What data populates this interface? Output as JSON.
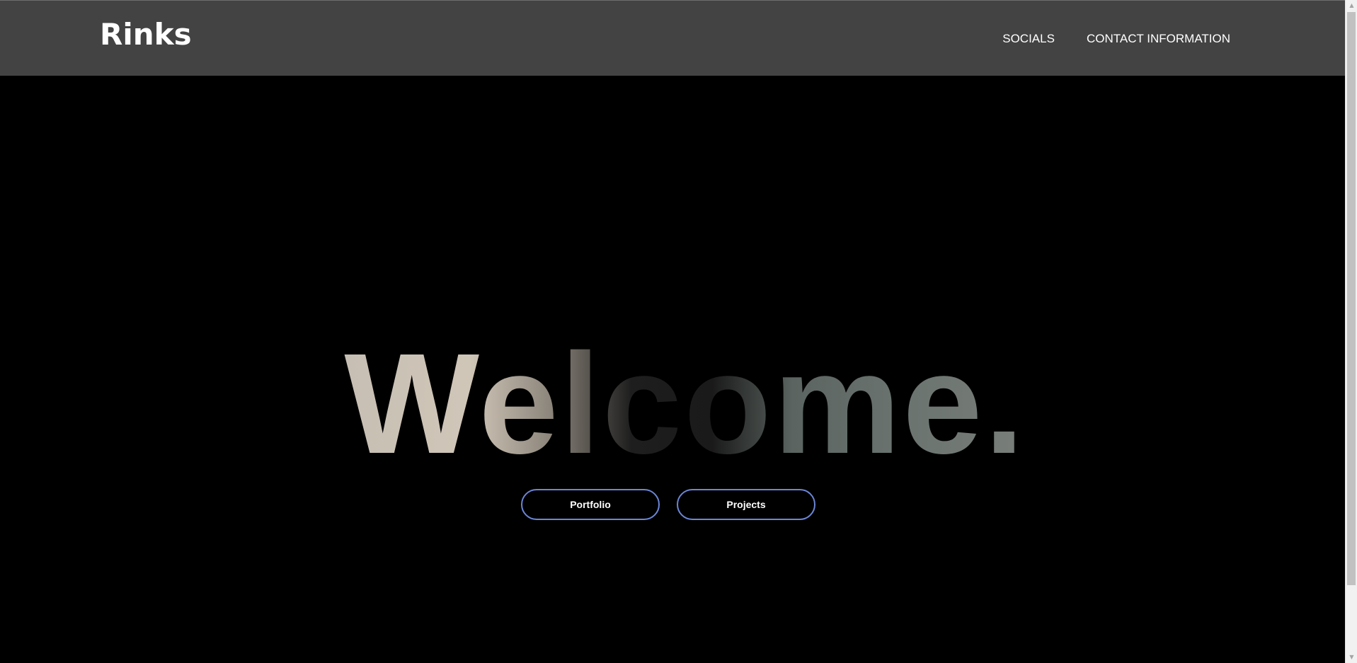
{
  "header": {
    "logo": "Rinks",
    "nav": [
      {
        "label": "SOCIALS"
      },
      {
        "label": "CONTACT INFORMATION"
      }
    ]
  },
  "hero": {
    "title": "Welcome.",
    "buttons": [
      {
        "label": "Portfolio"
      },
      {
        "label": "Projects"
      }
    ]
  },
  "colors": {
    "header_bg": "#434343",
    "page_bg": "#000000",
    "button_border": "#6b86d6",
    "text": "#ffffff"
  },
  "icons": {
    "scroll_up": "▲",
    "scroll_down": "▼"
  }
}
